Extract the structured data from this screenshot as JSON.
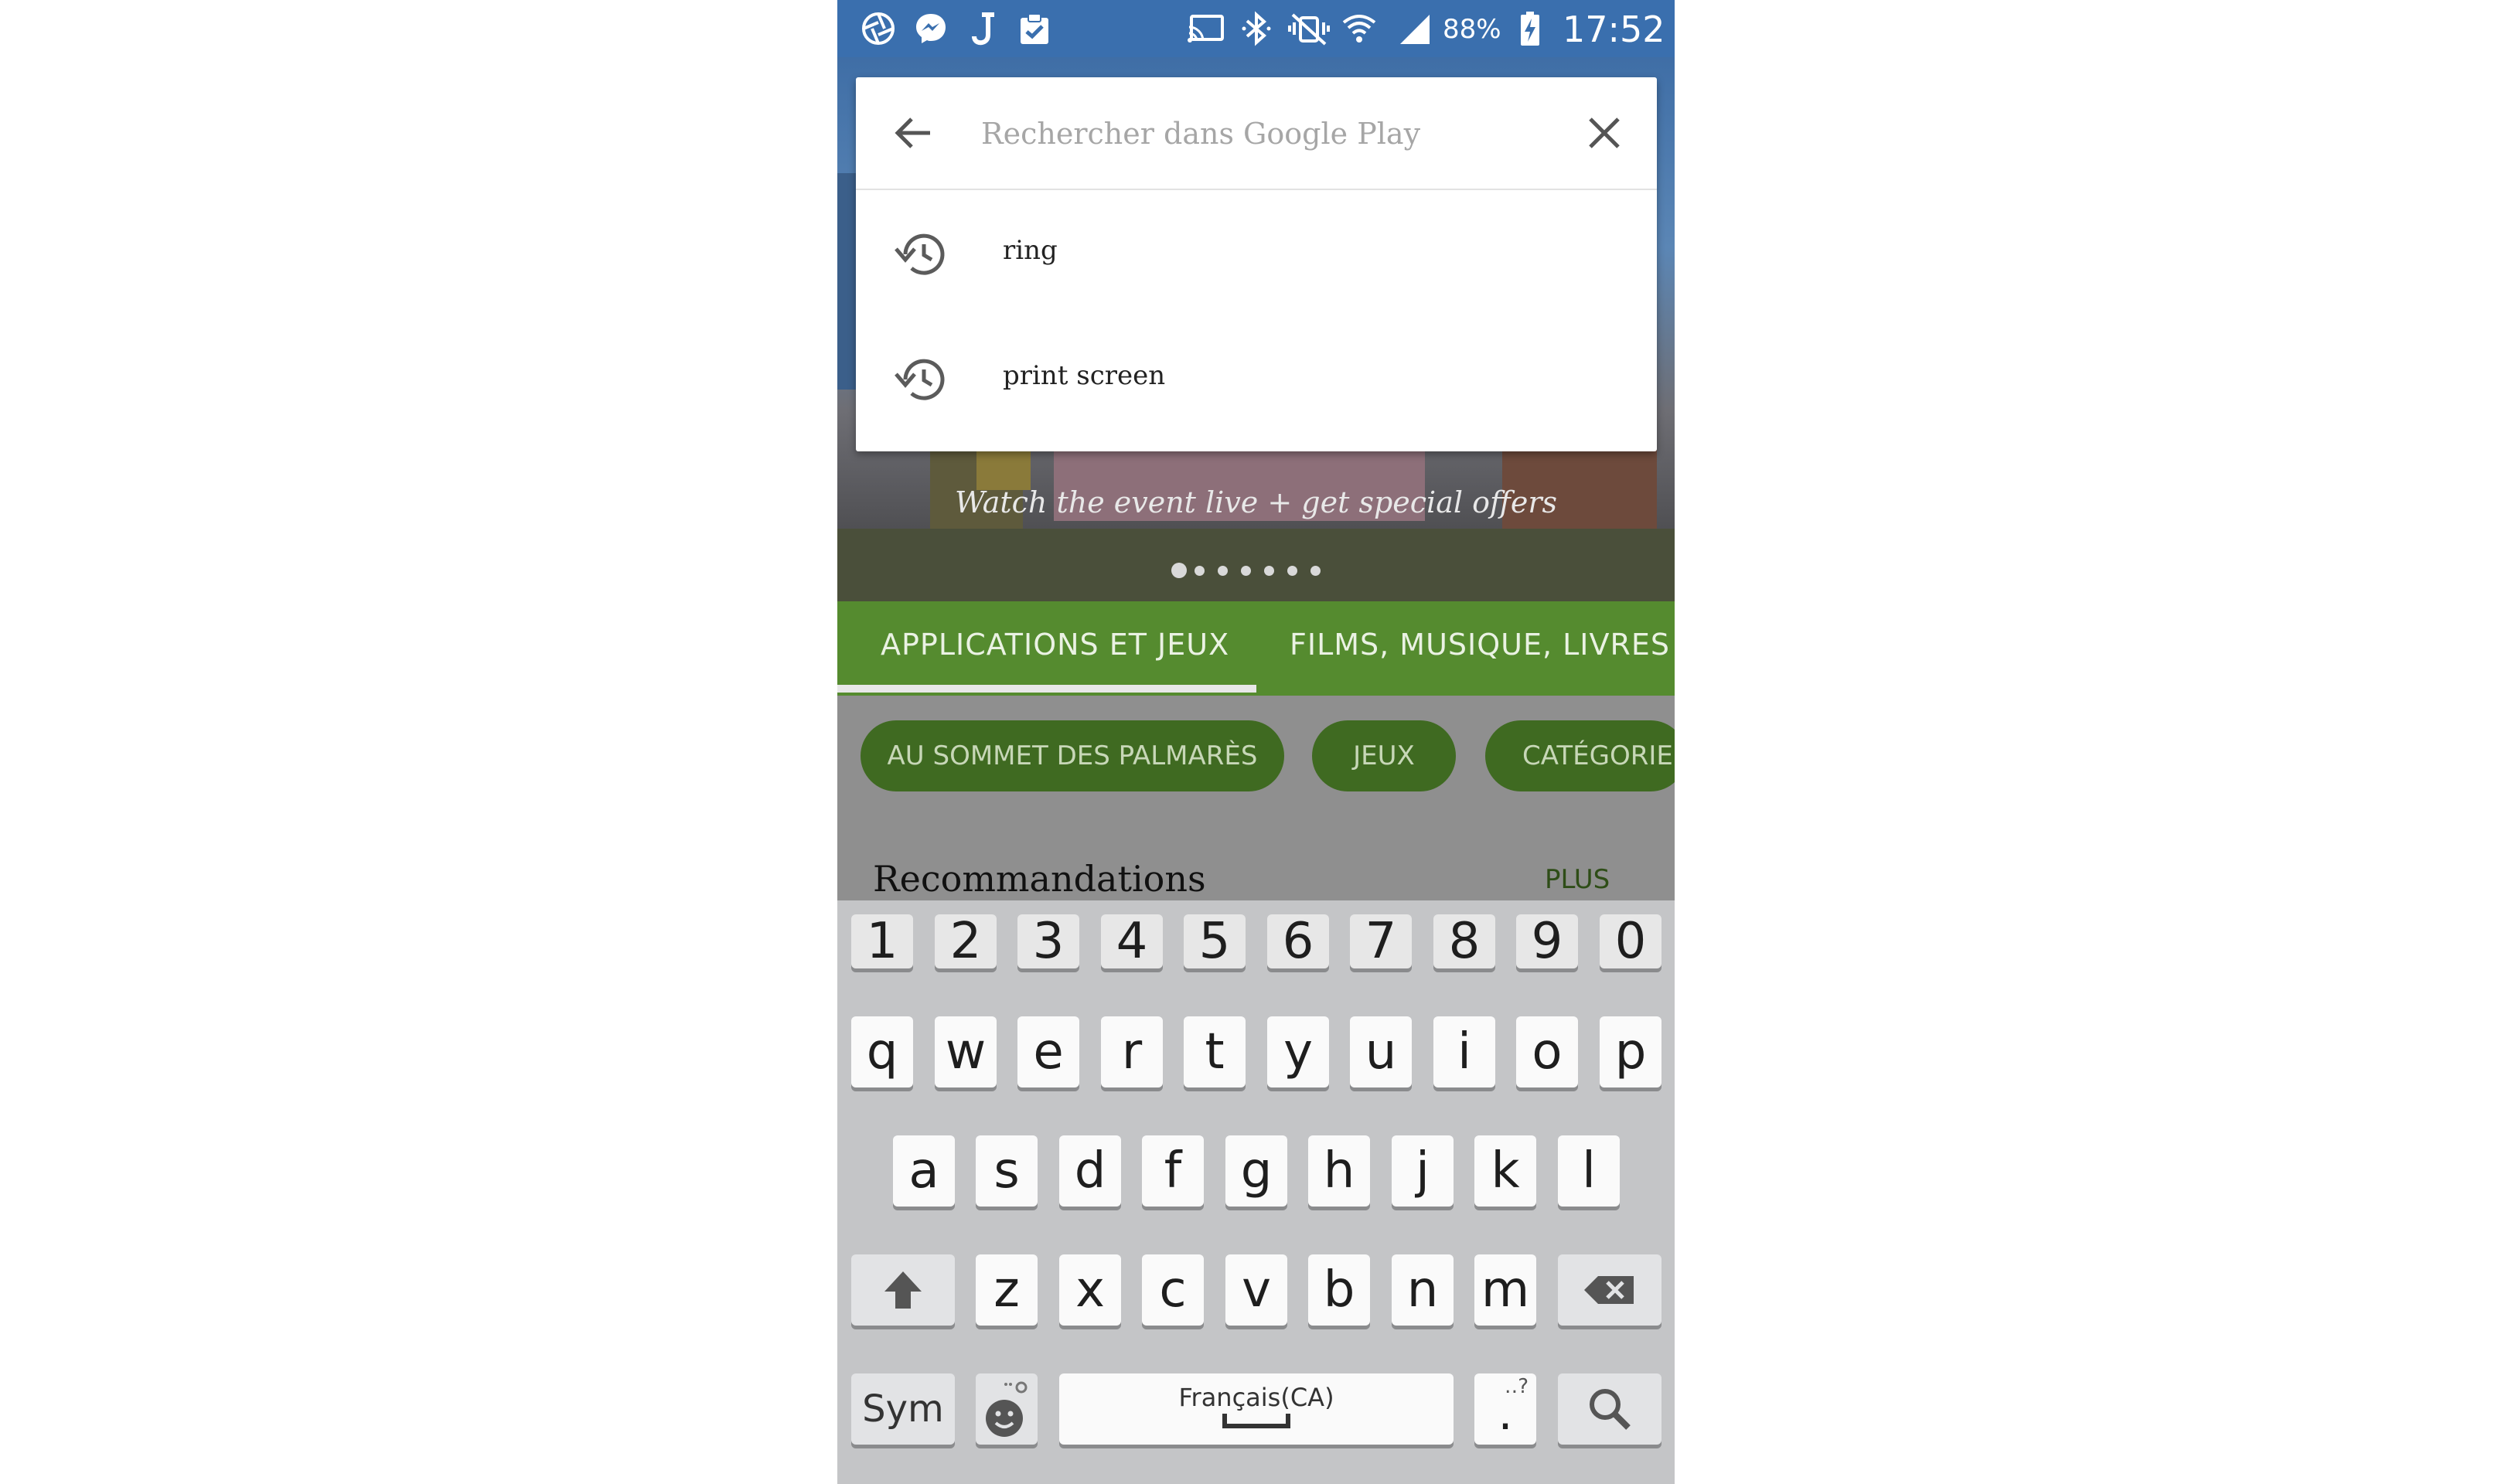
{
  "status_bar": {
    "left_icons": [
      "aperture-icon",
      "messenger-icon",
      "j-app-icon",
      "clipboard-check-icon"
    ],
    "right_icons": [
      "cast-icon",
      "bluetooth-icon",
      "vibrate-mute-icon",
      "wifi-icon",
      "signal-icon"
    ],
    "battery": "88%",
    "time": "17:52"
  },
  "search": {
    "placeholder": "Rechercher dans Google Play",
    "value": "",
    "suggestions": [
      {
        "label": "ring",
        "icon": "history-icon"
      },
      {
        "label": "print screen",
        "icon": "history-icon"
      }
    ]
  },
  "banner": {
    "caption": "Watch the event live + get special offers",
    "active_dot": 1,
    "dot_count": 7
  },
  "tabs": [
    {
      "label": "APPLICATIONS ET JEUX",
      "active": true
    },
    {
      "label": "FILMS, MUSIQUE, LIVRES",
      "active": false
    }
  ],
  "chips": [
    {
      "label": "AU SOMMET DES PALMARÈS"
    },
    {
      "label": "JEUX"
    },
    {
      "label": "CATÉGORIES"
    }
  ],
  "section": {
    "title": "Recommandations",
    "more": "PLUS"
  },
  "keyboard": {
    "number_row": [
      "1",
      "2",
      "3",
      "4",
      "5",
      "6",
      "7",
      "8",
      "9",
      "0"
    ],
    "row1": [
      "q",
      "w",
      "e",
      "r",
      "t",
      "y",
      "u",
      "i",
      "o",
      "p"
    ],
    "row2": [
      "a",
      "s",
      "d",
      "f",
      "g",
      "h",
      "j",
      "k",
      "l"
    ],
    "row3": [
      "z",
      "x",
      "c",
      "v",
      "b",
      "n",
      "m"
    ],
    "sym_label": "Sym",
    "space_label": "Français(CA)",
    "punct_label": ".",
    "punct_hint": "‥?"
  },
  "colors": {
    "status_bar": "#3a6fae",
    "tab_bar": "#558b2f",
    "chip": "#3f6a21",
    "keyboard_bg": "#c4c5c7"
  }
}
